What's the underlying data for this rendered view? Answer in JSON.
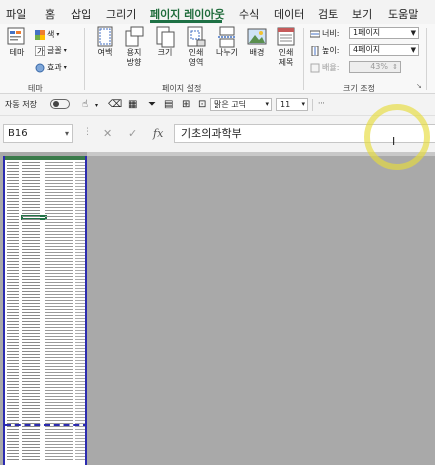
{
  "ribbon_tabs": [
    "파일",
    "홈",
    "삽입",
    "그리기",
    "페이지 레이아웃",
    "수식",
    "데이터",
    "검토",
    "보기",
    "도움말"
  ],
  "active_tab": "페이지 레이아웃",
  "ribbon": {
    "theme_group": {
      "label": "테마",
      "themes_button": "테마",
      "colors_button": "색",
      "fonts_button": "글꼴",
      "effects_button": "효과"
    },
    "page_setup_group": {
      "label": "페이지 설정",
      "margins": "여백",
      "orientation_line1": "용지",
      "orientation_line2": "방향",
      "size": "크기",
      "print_area_line1": "인쇄",
      "print_area_line2": "영역",
      "breaks": "나누기",
      "background": "배경",
      "print_titles_line1": "인쇄",
      "print_titles_line2": "제목"
    },
    "scale_group": {
      "label": "크기 조정",
      "width_label": "너비:",
      "width_value": "1페이지",
      "height_label": "높이:",
      "height_value": "4페이지",
      "scale_label": "배율:",
      "scale_value": "43%"
    }
  },
  "qat": {
    "autosave_label": "자동 저장",
    "font_name": "맑은 고딕",
    "font_size": "11"
  },
  "formula_bar": {
    "name_box": "B16",
    "cancel_icon": "✕",
    "enter_icon": "✓",
    "fx_label": "fx",
    "formula_value": "기초의과학부"
  },
  "colors": {
    "accent": "#1e7145",
    "page_border": "#2b2bb0",
    "sheet_background": "#a9a9a9",
    "highlight_halo": "#e6dc3c"
  },
  "cursor_icon": "text-cursor-icon"
}
